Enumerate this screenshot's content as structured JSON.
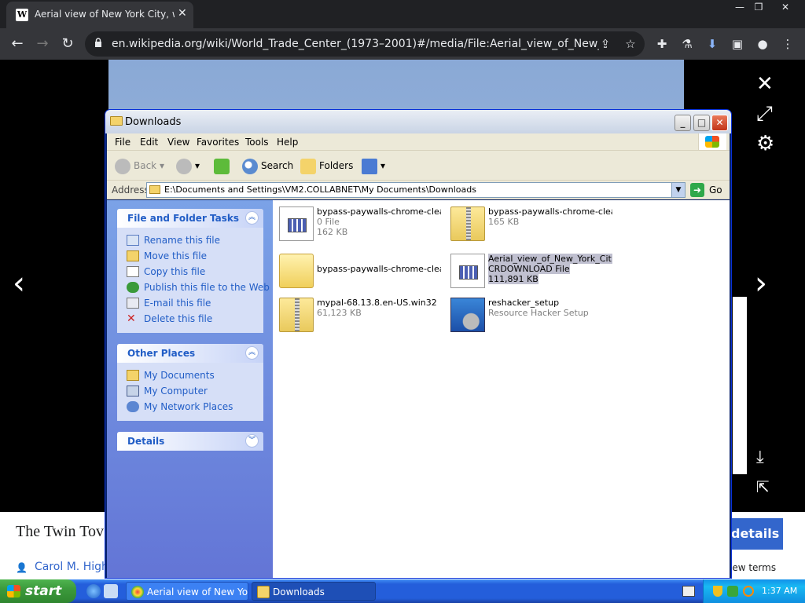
{
  "browser": {
    "tab_title": "Aerial view of New York City, with T",
    "favicon_letter": "W",
    "url": "en.wikipedia.org/wiki/World_Trade_Center_(1973–2001)#/media/File:Aerial_view_of_New_York_C...",
    "icons": [
      "back-icon",
      "forward-icon",
      "reload-icon",
      "lock-icon",
      "share-icon",
      "star-icon",
      "extension-icon",
      "flask-icon",
      "download-icon",
      "sidepanel-icon",
      "profile-icon",
      "menu-icon"
    ]
  },
  "page": {
    "caption_title": "The Twin Tov",
    "author": "Carol M. Highs",
    "details_label": "details",
    "terms_label": "iew terms"
  },
  "window": {
    "title": "Downloads",
    "menus": [
      "File",
      "Edit",
      "View",
      "Favorites",
      "Tools",
      "Help"
    ],
    "toolbar": {
      "back": "Back",
      "search": "Search",
      "folders": "Folders"
    },
    "address_label": "Address",
    "address_value": "E:\\Documents and Settings\\VM2.COLLABNET\\My Documents\\Downloads",
    "go_label": "Go",
    "tasks_title": "File and Folder Tasks",
    "tasks": [
      "Rename this file",
      "Move this file",
      "Copy this file",
      "Publish this file to the Web",
      "E-mail this file",
      "Delete this file"
    ],
    "places_title": "Other Places",
    "places": [
      "My Documents",
      "My Computer",
      "My Network Places"
    ],
    "details_title": "Details",
    "files": [
      {
        "name": "bypass-paywalls-chrome-clea...",
        "line2": "0 File",
        "line3": "162 KB",
        "icon": "doc"
      },
      {
        "name": "bypass-paywalls-chrome-clea...",
        "line2": "165 KB",
        "line3": "",
        "icon": "zip"
      },
      {
        "name": "bypass-paywalls-chrome-clea...",
        "line2": "",
        "line3": "",
        "icon": "folder"
      },
      {
        "name": "Aerial_view_of_New_York_Cit...",
        "line2": "CRDOWNLOAD File",
        "line3": "111,891 KB",
        "icon": "doc"
      },
      {
        "name": "mypal-68.13.8.en-US.win32",
        "line2": "61,123 KB",
        "line3": "",
        "icon": "zip"
      },
      {
        "name": "reshacker_setup",
        "line2": "Resource Hacker Setup",
        "line3": "",
        "icon": "setup"
      }
    ]
  },
  "taskbar": {
    "start_label": "start",
    "tasks": [
      "Aerial view of New Yo...",
      "Downloads"
    ],
    "clock": "1:37 AM"
  }
}
